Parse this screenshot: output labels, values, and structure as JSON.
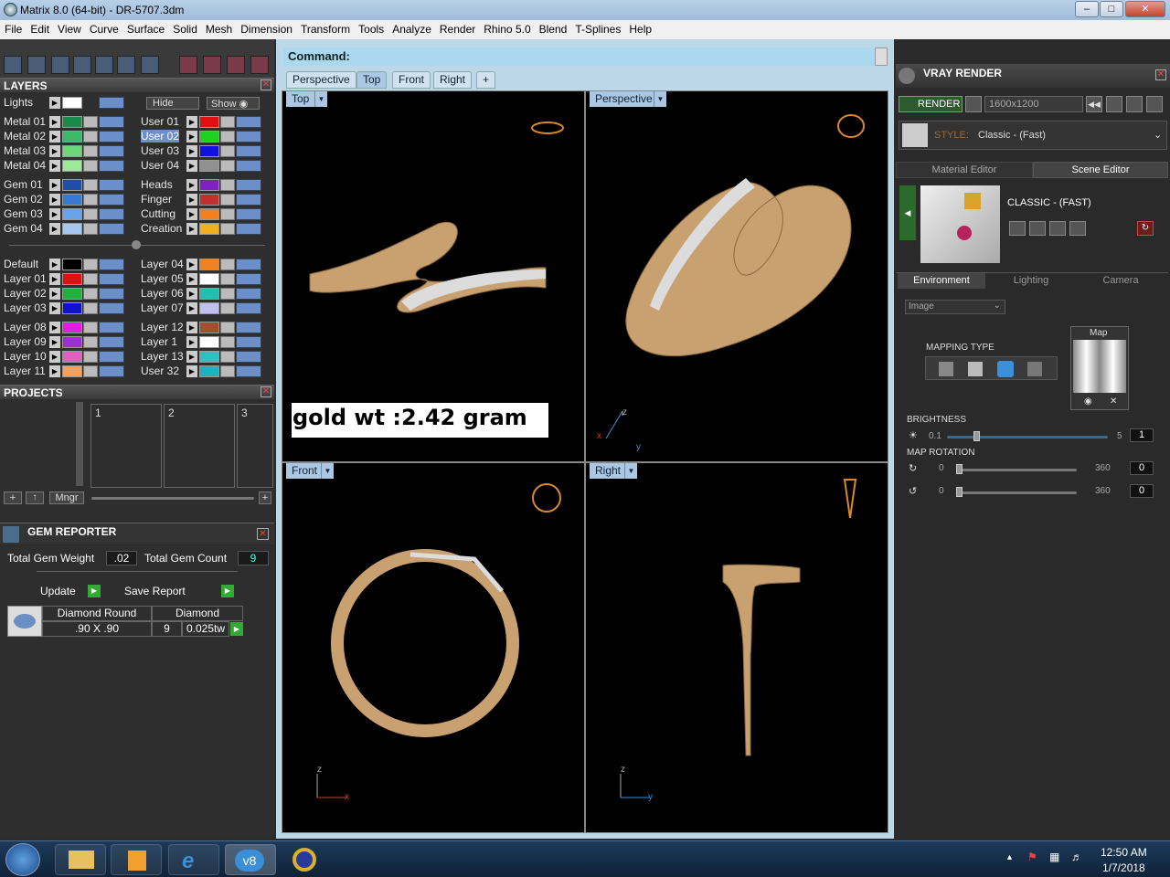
{
  "window": {
    "title": "Matrix 8.0 (64-bit) - DR-5707.3dm"
  },
  "menu": [
    "File",
    "Edit",
    "View",
    "Curve",
    "Surface",
    "Solid",
    "Mesh",
    "Dimension",
    "Transform",
    "Tools",
    "Analyze",
    "Render",
    "Rhino 5.0",
    "Blend",
    "T-Splines",
    "Help"
  ],
  "layers": {
    "title": "LAYERS",
    "lights": "Lights",
    "hide": "Hide",
    "show": "Show",
    "left_col": [
      {
        "name": "Metal 01",
        "color": "#1a8a4a"
      },
      {
        "name": "Metal 02",
        "color": "#3bb86a"
      },
      {
        "name": "Metal 03",
        "color": "#6ed67a"
      },
      {
        "name": "Metal 04",
        "color": "#9ee89a"
      },
      {
        "name": "Gem 01",
        "color": "#1d4fa8"
      },
      {
        "name": "Gem 02",
        "color": "#3a78d0"
      },
      {
        "name": "Gem 03",
        "color": "#6aa4e8"
      },
      {
        "name": "Gem 04",
        "color": "#a4c8f0"
      },
      {
        "name": "Default",
        "color": "#000000"
      },
      {
        "name": "Layer 01",
        "color": "#e01010"
      },
      {
        "name": "Layer 02",
        "color": "#20b040"
      },
      {
        "name": "Layer 03",
        "color": "#1010d0"
      },
      {
        "name": "Layer 08",
        "color": "#e020e0"
      },
      {
        "name": "Layer 09",
        "color": "#9a30d0"
      },
      {
        "name": "Layer 10",
        "color": "#e060c0"
      },
      {
        "name": "Layer 11",
        "color": "#f0a060"
      }
    ],
    "right_col": [
      {
        "name": "User 01",
        "color": "#e01010"
      },
      {
        "name": "User 02",
        "color": "#20d020"
      },
      {
        "name": "User 03",
        "color": "#1010e0"
      },
      {
        "name": "User 04",
        "color": "#909090"
      },
      {
        "name": "Heads",
        "color": "#8020c0"
      },
      {
        "name": "Finger",
        "color": "#c03030"
      },
      {
        "name": "Cutting",
        "color": "#f08020"
      },
      {
        "name": "Creation",
        "color": "#f0b020"
      },
      {
        "name": "Layer 04",
        "color": "#f08020"
      },
      {
        "name": "Layer 05",
        "color": "#ffffff"
      },
      {
        "name": "Layer 06",
        "color": "#20c0b0"
      },
      {
        "name": "Layer 07",
        "color": "#c0c0f0"
      },
      {
        "name": "Layer 12",
        "color": "#a05030"
      },
      {
        "name": "Layer 1",
        "color": "#ffffff"
      },
      {
        "name": "Layer 13",
        "color": "#30c0c0"
      },
      {
        "name": "User 32",
        "color": "#20b0c0"
      }
    ]
  },
  "projects": {
    "title": "PROJECTS",
    "slots": [
      "1",
      "2",
      "3"
    ],
    "mngr": "Mngr"
  },
  "gem_reporter": {
    "title": "GEM REPORTER",
    "weight_label": "Total Gem Weight",
    "weight": ".02",
    "count_label": "Total Gem Count",
    "count": "9",
    "update": "Update",
    "save": "Save Report",
    "row": {
      "shape": "Diamond Round",
      "material": "Diamond",
      "size": ".90 X .90",
      "qty": "9",
      "tw": "0.025tw"
    }
  },
  "command": {
    "label": "Command:"
  },
  "view_tabs": [
    "Perspective",
    "Top",
    "Front",
    "Right",
    "+"
  ],
  "active_tab": "Top",
  "viewports": {
    "top": "Top",
    "perspective": "Perspective",
    "front": "Front",
    "right": "Right"
  },
  "annotation": "gold wt :2.42 gram",
  "axes": {
    "x": "x",
    "y": "y",
    "z": "z"
  },
  "vray": {
    "title": "VRAY RENDER",
    "render": "RENDER",
    "resolution": "1600x1200",
    "style_label": "STYLE:",
    "style": "Classic - (Fast)",
    "tabs": [
      "Material Editor",
      "Scene Editor"
    ],
    "scene_name": "CLASSIC - (FAST)",
    "env_tabs": [
      "Environment",
      "Lighting",
      "Camera"
    ],
    "env_mode": "Image",
    "mapping_type": "MAPPING TYPE",
    "map": "Map",
    "brightness": {
      "label": "BRIGHTNESS",
      "min": "0.1",
      "max": "5",
      "value": "1"
    },
    "rotation": {
      "label": "MAP ROTATION",
      "r1": {
        "min": "0",
        "max": "360",
        "value": "0"
      },
      "r2": {
        "min": "0",
        "max": "360",
        "value": "0"
      }
    }
  },
  "clock": {
    "time": "12:50 AM",
    "date": "1/7/2018"
  }
}
